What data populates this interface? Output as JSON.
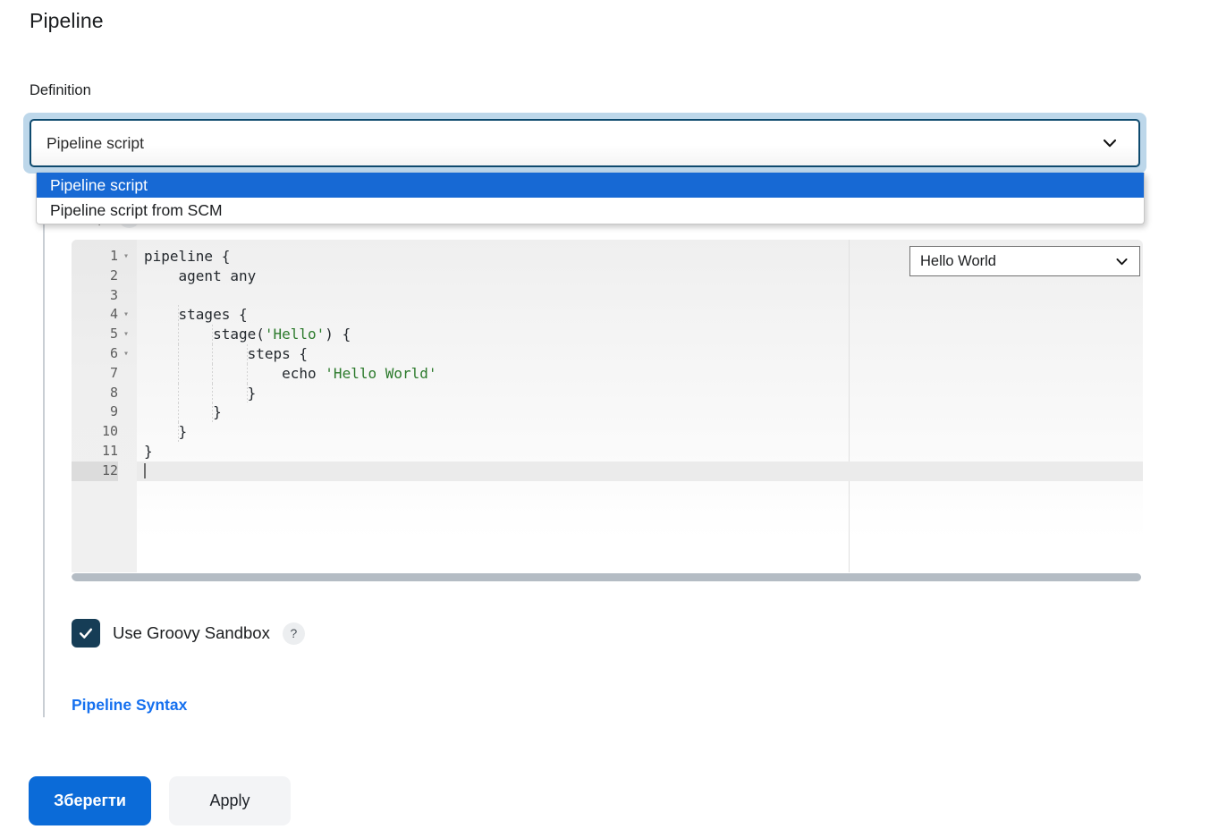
{
  "page": {
    "title": "Pipeline"
  },
  "definition": {
    "label": "Definition",
    "selected": "Pipeline script",
    "chevron_icon": "chevron-down-icon",
    "options": [
      {
        "label": "Pipeline script",
        "selected": true
      },
      {
        "label": "Pipeline script from SCM",
        "selected": false
      }
    ]
  },
  "script": {
    "label": "Script",
    "help_icon": "?",
    "sample_selector": {
      "selected": "Hello World",
      "chevron_icon": "chevron-down-icon"
    },
    "editor": {
      "active_line": 12,
      "lines": [
        {
          "num": "1",
          "fold": "▾",
          "indent": 0,
          "segments": [
            {
              "text": "pipeline {",
              "type": "code"
            }
          ]
        },
        {
          "num": "2",
          "fold": "",
          "indent": 0,
          "segments": [
            {
              "text": "    agent any",
              "type": "code"
            }
          ]
        },
        {
          "num": "3",
          "fold": "",
          "indent": 0,
          "segments": [
            {
              "text": "",
              "type": "code"
            }
          ]
        },
        {
          "num": "4",
          "fold": "▾",
          "indent": 1,
          "segments": [
            {
              "text": "    stages {",
              "type": "code"
            }
          ]
        },
        {
          "num": "5",
          "fold": "▾",
          "indent": 2,
          "segments": [
            {
              "text": "        stage(",
              "type": "code"
            },
            {
              "text": "'Hello'",
              "type": "string"
            },
            {
              "text": ") {",
              "type": "code"
            }
          ]
        },
        {
          "num": "6",
          "fold": "▾",
          "indent": 3,
          "segments": [
            {
              "text": "            steps {",
              "type": "code"
            }
          ]
        },
        {
          "num": "7",
          "fold": "",
          "indent": 3,
          "segments": [
            {
              "text": "                echo ",
              "type": "code"
            },
            {
              "text": "'Hello World'",
              "type": "string"
            }
          ]
        },
        {
          "num": "8",
          "fold": "",
          "indent": 3,
          "segments": [
            {
              "text": "            }",
              "type": "code"
            }
          ]
        },
        {
          "num": "9",
          "fold": "",
          "indent": 2,
          "segments": [
            {
              "text": "        }",
              "type": "code"
            }
          ]
        },
        {
          "num": "10",
          "fold": "",
          "indent": 1,
          "segments": [
            {
              "text": "    }",
              "type": "code"
            }
          ]
        },
        {
          "num": "11",
          "fold": "",
          "indent": 0,
          "segments": [
            {
              "text": "}",
              "type": "code"
            }
          ]
        },
        {
          "num": "12",
          "fold": "",
          "indent": 0,
          "segments": [
            {
              "text": "",
              "type": "code"
            }
          ]
        }
      ]
    }
  },
  "sandbox": {
    "label": "Use Groovy Sandbox",
    "checked": true,
    "check_icon": "check-icon",
    "help_icon": "?"
  },
  "pipeline_syntax": {
    "label": "Pipeline Syntax"
  },
  "footer": {
    "save_label": "Зберегти",
    "apply_label": "Apply"
  },
  "colors": {
    "primary_blue": "#0b6bd8",
    "dropdown_highlight": "#1769d4",
    "link_blue": "#1570ef",
    "checkbox_navy": "#163d56",
    "focus_ring": "#bdd7ea",
    "select_border": "#0e4a6e",
    "string_green": "#2c7a2c"
  }
}
